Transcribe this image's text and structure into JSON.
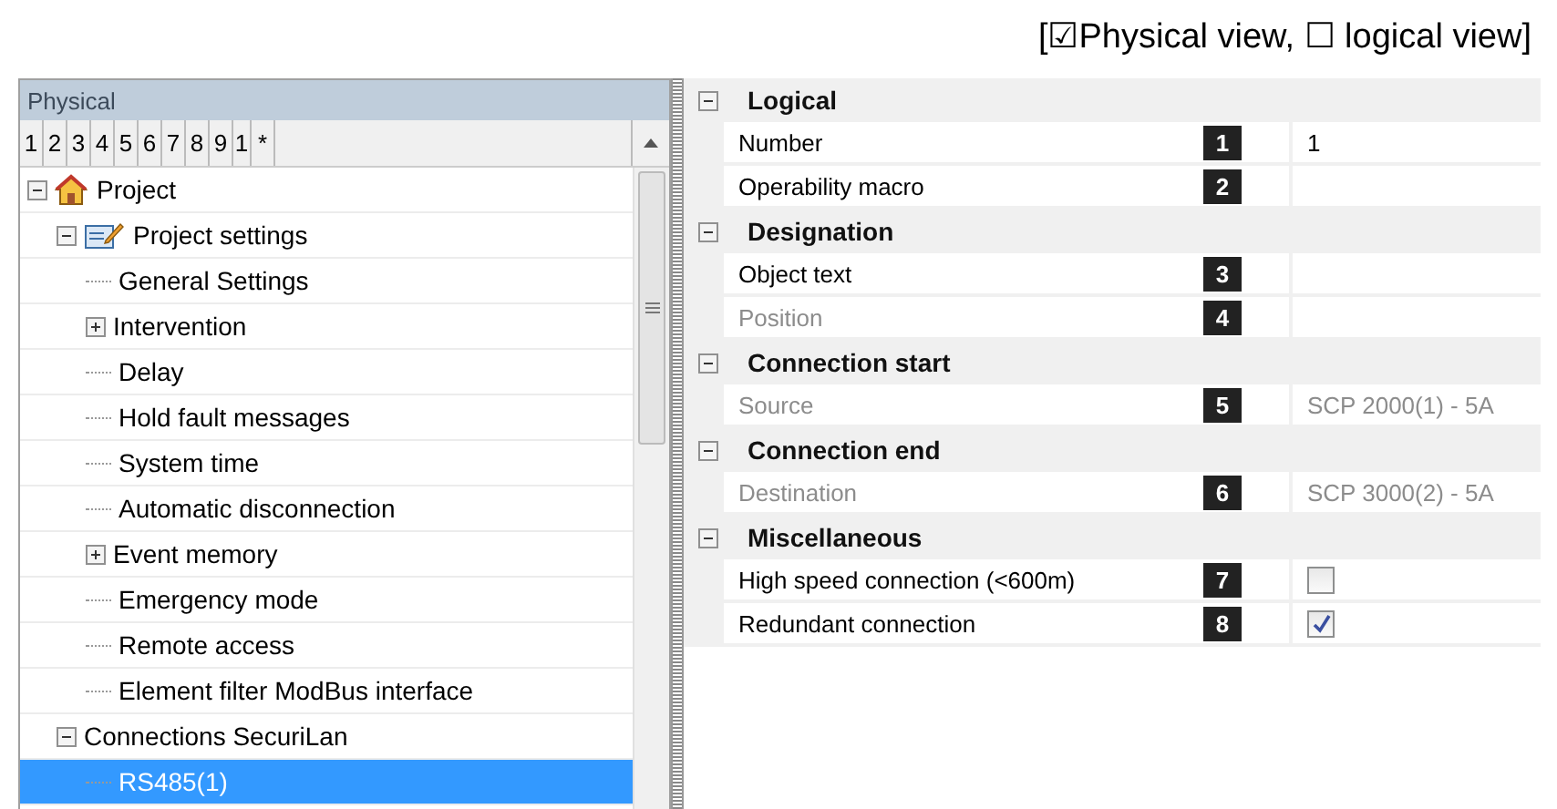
{
  "caption": "[☑Physical view, ☐ logical view]",
  "tree_panel": {
    "title": "Physical",
    "tabs": [
      "1",
      "2",
      "3",
      "4",
      "5",
      "6",
      "7",
      "8",
      "9",
      "1",
      "*"
    ],
    "items": [
      {
        "label": "Project",
        "expanded": true,
        "selected": false,
        "children": [
          {
            "label": "Project settings",
            "expanded": true,
            "selected": false,
            "children": [
              {
                "label": "General Settings",
                "selected": false
              },
              {
                "label": "Intervention",
                "expanded": false,
                "selected": false
              },
              {
                "label": "Delay",
                "selected": false
              },
              {
                "label": "Hold fault messages",
                "selected": false
              },
              {
                "label": "System time",
                "selected": false
              },
              {
                "label": "Automatic disconnection",
                "selected": false
              },
              {
                "label": "Event memory",
                "expanded": false,
                "selected": false
              },
              {
                "label": "Emergency mode",
                "selected": false
              },
              {
                "label": "Remote access",
                "selected": false
              },
              {
                "label": "Element filter ModBus interface",
                "selected": false
              }
            ]
          },
          {
            "label": "Connections SecuriLan",
            "expanded": true,
            "selected": false,
            "children": [
              {
                "label": "RS485(1)",
                "selected": true
              }
            ]
          }
        ]
      }
    ]
  },
  "properties": [
    {
      "category": "Logical",
      "expanded": true,
      "rows": [
        {
          "label": "Number",
          "badge": "1",
          "kind": "text",
          "value": "1",
          "disabled": false
        },
        {
          "label": "Operability macro",
          "badge": "2",
          "kind": "text",
          "disabled": false
        }
      ]
    },
    {
      "category": "Designation",
      "expanded": true,
      "rows": [
        {
          "label": "Object text",
          "badge": "3",
          "kind": "text",
          "disabled": false
        },
        {
          "label": "Position",
          "badge": "4",
          "kind": "text",
          "disabled": true
        }
      ]
    },
    {
      "category": "Connection start",
      "expanded": true,
      "rows": [
        {
          "label": "Source",
          "badge": "5",
          "kind": "text",
          "value": "SCP 2000(1) - 5A",
          "disabled": true
        }
      ]
    },
    {
      "category": "Connection end",
      "expanded": true,
      "rows": [
        {
          "label": "Destination",
          "badge": "6",
          "kind": "text",
          "value": "SCP 3000(2) - 5A",
          "disabled": true
        }
      ]
    },
    {
      "category": "Miscellaneous",
      "expanded": true,
      "rows": [
        {
          "label": "High speed connection (<600m)",
          "badge": "7",
          "kind": "checkbox",
          "checked": false,
          "disabled": false
        },
        {
          "label": "Redundant connection",
          "badge": "8",
          "kind": "checkbox",
          "checked": true,
          "disabled": false
        }
      ]
    }
  ]
}
